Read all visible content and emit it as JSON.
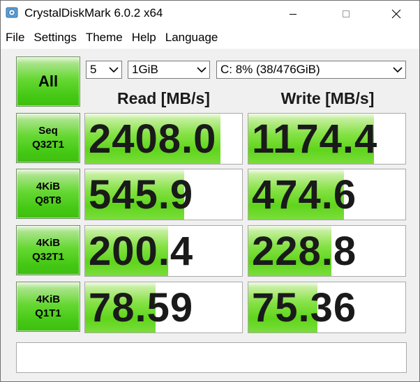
{
  "window": {
    "title": "CrystalDiskMark 6.0.2 x64"
  },
  "menu": [
    "File",
    "Settings",
    "Theme",
    "Help",
    "Language"
  ],
  "controls": {
    "all_label": "All",
    "count_value": "5",
    "size_value": "1GiB",
    "drive_value": "C: 8% (38/476GiB)"
  },
  "headers": {
    "read": "Read [MB/s]",
    "write": "Write [MB/s]"
  },
  "tests": [
    {
      "line1": "Seq",
      "line2": "Q32T1",
      "read": "2408.0",
      "write": "1174.4",
      "read_fill": 0.86,
      "write_fill": 0.8
    },
    {
      "line1": "4KiB",
      "line2": "Q8T8",
      "read": "545.9",
      "write": "474.6",
      "read_fill": 0.63,
      "write_fill": 0.61
    },
    {
      "line1": "4KiB",
      "line2": "Q32T1",
      "read": "200.4",
      "write": "228.8",
      "read_fill": 0.53,
      "write_fill": 0.53
    },
    {
      "line1": "4KiB",
      "line2": "Q1T1",
      "read": "78.59",
      "write": "75.36",
      "read_fill": 0.45,
      "write_fill": 0.44
    }
  ],
  "status_text": ""
}
